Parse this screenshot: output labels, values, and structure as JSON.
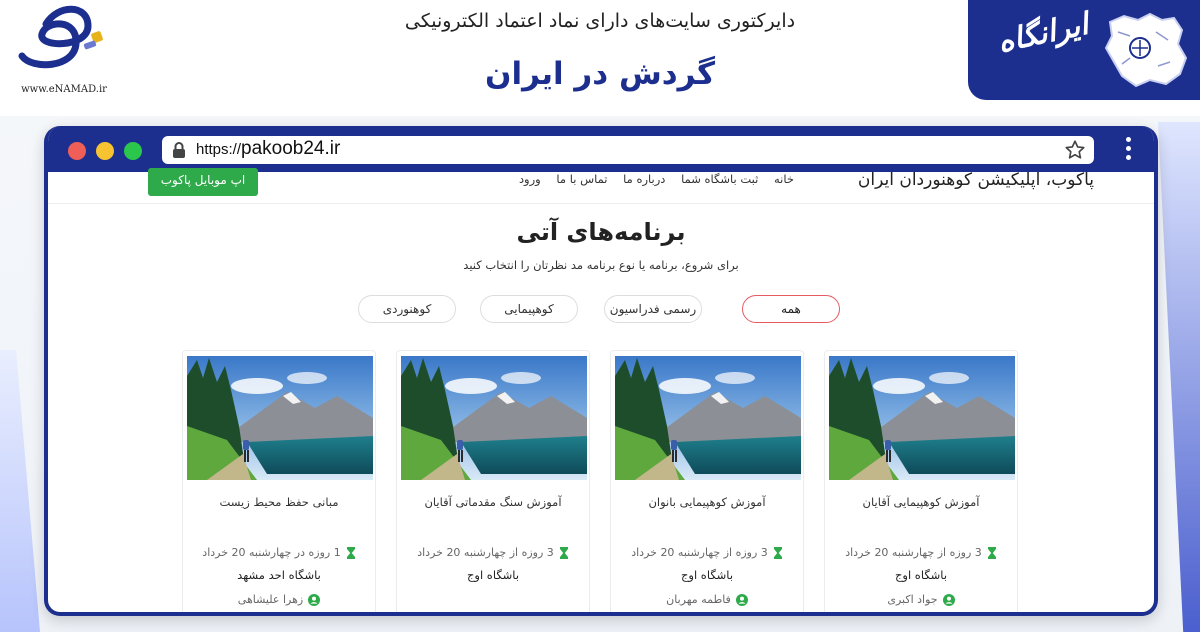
{
  "enamad": {
    "url": "www.eNAMAD.ir"
  },
  "header": {
    "directory_title": "دایرکتوری سایت‌های دارای نماد اعتماد الکترونیکی",
    "site_title": "گردش در ایران",
    "logo_text": "ایرانگاه"
  },
  "browser": {
    "url_protocol": "https://",
    "url_domain": "pakoob24.ir"
  },
  "site": {
    "brand": "پاکوب، اپلیکیشن کوهنوردان ایران",
    "nav_links": [
      "خانه",
      "ثبت باشگاه شما",
      "درباره ما",
      "تماس با ما",
      "ورود"
    ],
    "app_button": "اپ موبایل پاکوب",
    "section_title": "برنامه‌های آتی",
    "section_subtitle": "برای شروع، برنامه یا نوع برنامه مد نظرتان را انتخاب کنید",
    "filters": [
      "همه",
      "رسمی فدراسیون",
      "کوهپیمایی",
      "کوهنوردی"
    ],
    "active_filter": "همه",
    "cards": [
      {
        "title": "آموزش کوهپیمایی آقایان",
        "meta": "3 روزه از چهارشنبه 20 خرداد",
        "club": "باشگاه اوج",
        "person": "جواد اکبری"
      },
      {
        "title": "آموزش کوهپیمایی بانوان",
        "meta": "3 روزه از چهارشنبه 20 خرداد",
        "club": "باشگاه اوج",
        "person": "فاطمه مهربان"
      },
      {
        "title": "آموزش سنگ مقدماتی آقایان",
        "meta": "3 روزه از چهارشنبه 20 خرداد",
        "club": "باشگاه اوج",
        "person": ""
      },
      {
        "title": "مبانی حفظ محیط زیست",
        "meta": "1 روزه در چهارشنبه 20 خرداد",
        "club": "باشگاه احد مشهد",
        "person": "زهرا علیشاهی"
      }
    ]
  },
  "colors": {
    "brand_blue": "#1c2f8f",
    "app_green": "#2eaa4a",
    "active_pill": "#e85a62",
    "icon_green": "#2eaa4a"
  },
  "icons": {
    "meta": "hourglass-icon",
    "person": "user-circle-icon",
    "lock": "lock-icon",
    "bookmark": "star-icon",
    "menu": "kebab-menu-icon"
  }
}
